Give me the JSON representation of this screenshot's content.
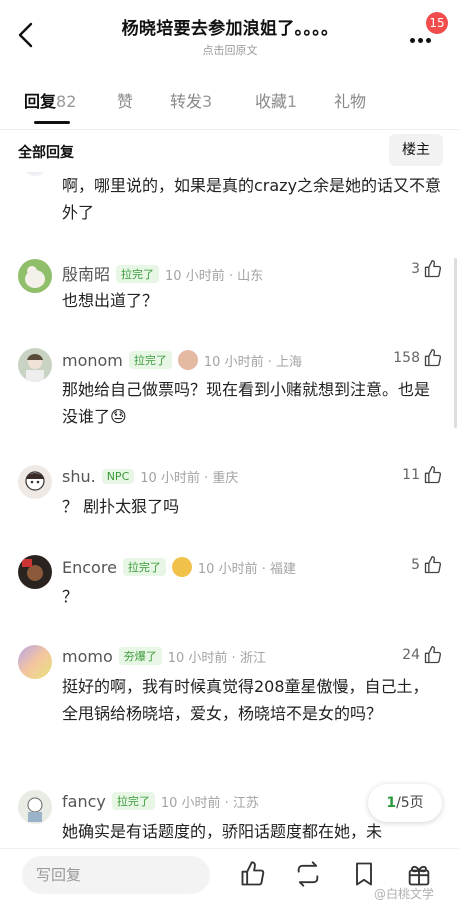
{
  "header": {
    "title": "杨晓培要去参加浪姐了。。。。",
    "subtitle": "点击回原文",
    "notification_count": "15"
  },
  "tabs": [
    {
      "label": "回复",
      "count": "82"
    },
    {
      "label": "赞",
      "count": ""
    },
    {
      "label": "转发",
      "count": "3"
    },
    {
      "label": "收藏",
      "count": "1"
    },
    {
      "label": "礼物",
      "count": ""
    }
  ],
  "filter": {
    "label": "全部回复",
    "owner_button": "楼主"
  },
  "first_comment_tail": "啊，哪里说的，如果是真的crazy之余是她的话又不意外了",
  "comments": [
    {
      "name": "殷南昭",
      "tag": "拉完了",
      "meta": "10 小时前 · 山东",
      "likes": "3",
      "text": "也想出道了？"
    },
    {
      "name": "monom",
      "tag": "拉完了",
      "meta": "10 小时前 · 上海",
      "likes": "158",
      "text": "那她给自己做票吗？现在看到小赌就想到注意。也是没谁了😓"
    },
    {
      "name": "shu.",
      "tag": "NPC",
      "meta": "10 小时前 · 重庆",
      "likes": "11",
      "text": "？ 剧扑太狠了吗"
    },
    {
      "name": "Encore",
      "tag": "拉完了",
      "meta": "10 小时前 · 福建",
      "likes": "5",
      "text": "？"
    },
    {
      "name": "momo",
      "tag": "夯爆了",
      "meta": "10 小时前 · 浙江",
      "likes": "24",
      "text": "挺好的啊，我有时候真觉得208童星傲慢，自己土，全甩锅给杨晓培，爱女，杨晓培不是女的吗？"
    },
    {
      "name": "fancy",
      "tag": "拉完了",
      "meta": "10 小时前 · 江苏",
      "likes": "",
      "text": "她确实是有话题度的，骄阳话题度都在她，未"
    }
  ],
  "pagination": {
    "current": "1",
    "total": "/5页"
  },
  "bottom_bar": {
    "reply_placeholder": "写回复",
    "watermark": "@白桃文学"
  },
  "colors": {
    "accent": "#2a9a3a",
    "tag_bg": "#e7f6e5",
    "badge": "#f24c4c"
  }
}
